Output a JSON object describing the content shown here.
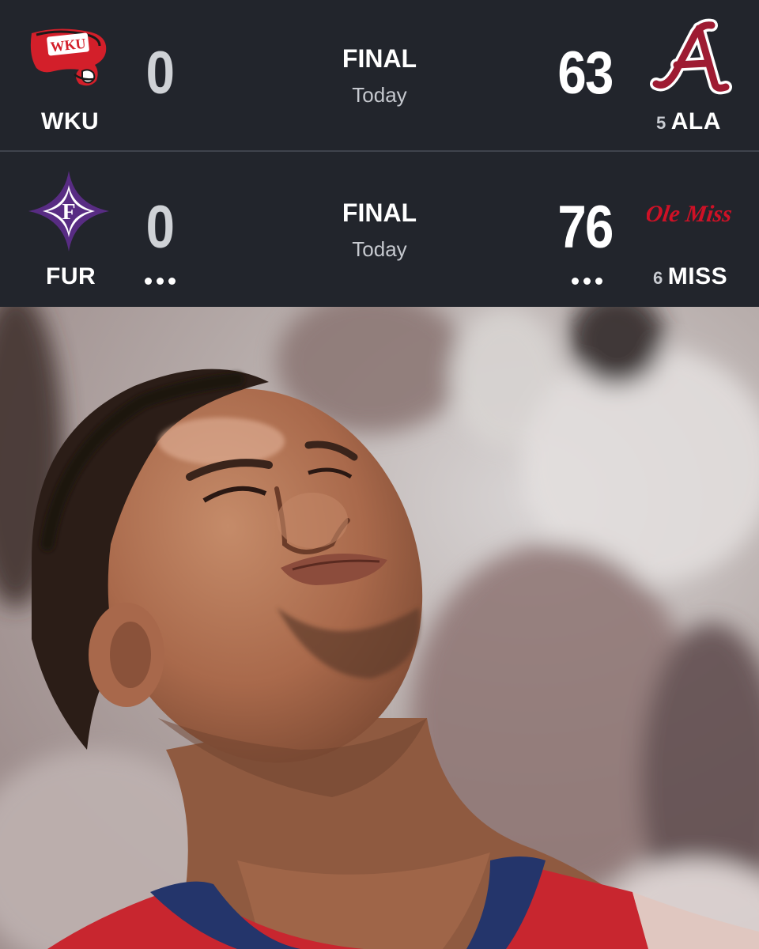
{
  "games": [
    {
      "away": {
        "abbr": "WKU",
        "rank": "",
        "score": "0",
        "logo_icon": "wku-logo-icon",
        "color": "#d31f2a"
      },
      "home": {
        "abbr": "ALA",
        "rank": "5",
        "score": "63",
        "logo_icon": "alabama-logo-icon",
        "color": "#9e1b32"
      },
      "status": "FINAL",
      "date": "Today",
      "has_more": false
    },
    {
      "away": {
        "abbr": "FUR",
        "rank": "",
        "score": "0",
        "logo_icon": "furman-logo-icon",
        "color": "#582c83"
      },
      "home": {
        "abbr": "MISS",
        "rank": "6",
        "score": "76",
        "logo_icon": "ole-miss-logo-icon",
        "color": "#ce1126",
        "wordmark": "Ole Miss"
      },
      "status": "FINAL",
      "date": "Today",
      "has_more": true
    }
  ],
  "colors": {
    "scoreboard_bg": "#22252c",
    "divider": "#3f434c",
    "text": "#ffffff"
  },
  "photo": {
    "subject": "player-looking-up-photo"
  }
}
